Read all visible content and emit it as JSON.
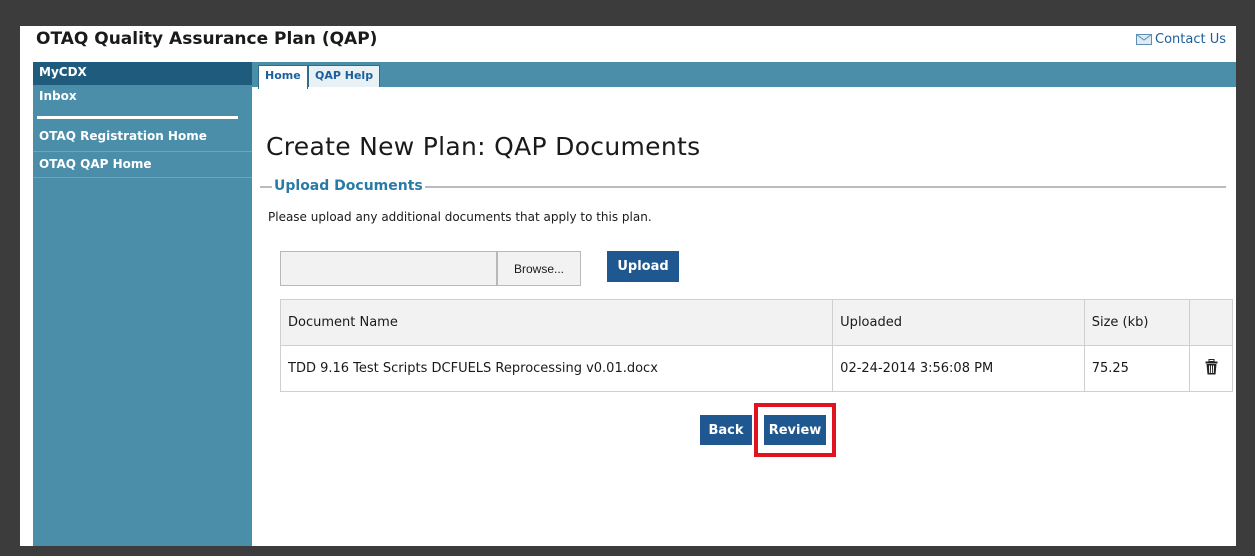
{
  "app": {
    "title": "OTAQ Quality Assurance Plan (QAP)",
    "contact_label": "Contact Us"
  },
  "sidebar": {
    "items": [
      {
        "label": "MyCDX"
      },
      {
        "label": "Inbox"
      },
      {
        "label": "OTAQ Registration Home"
      },
      {
        "label": "OTAQ QAP Home"
      }
    ]
  },
  "tabs": [
    {
      "label": "Home",
      "active": true
    },
    {
      "label": "QAP Help",
      "active": false
    }
  ],
  "main": {
    "page_title": "Create New Plan: QAP Documents",
    "section_legend": "Upload Documents",
    "instructions": "Please upload any additional documents that apply to this plan.",
    "file_input_value": "",
    "browse_label": "Browse...",
    "upload_label": "Upload"
  },
  "table": {
    "headers": [
      "Document Name",
      "Uploaded",
      "Size (kb)",
      ""
    ],
    "rows": [
      {
        "name": "TDD 9.16 Test Scripts DCFUELS Reprocessing v0.01.docx",
        "uploaded": "02-24-2014 3:56:08 PM",
        "size": "75.25",
        "action_icon": "trash-icon"
      }
    ]
  },
  "actions": {
    "back_label": "Back",
    "review_label": "Review",
    "highlight_color": "#e0141e"
  },
  "colors": {
    "sidebar": "#4b8eaa",
    "sidebar_active": "#1f5b7d",
    "button": "#1f5790",
    "legend": "#2a7aa8"
  }
}
